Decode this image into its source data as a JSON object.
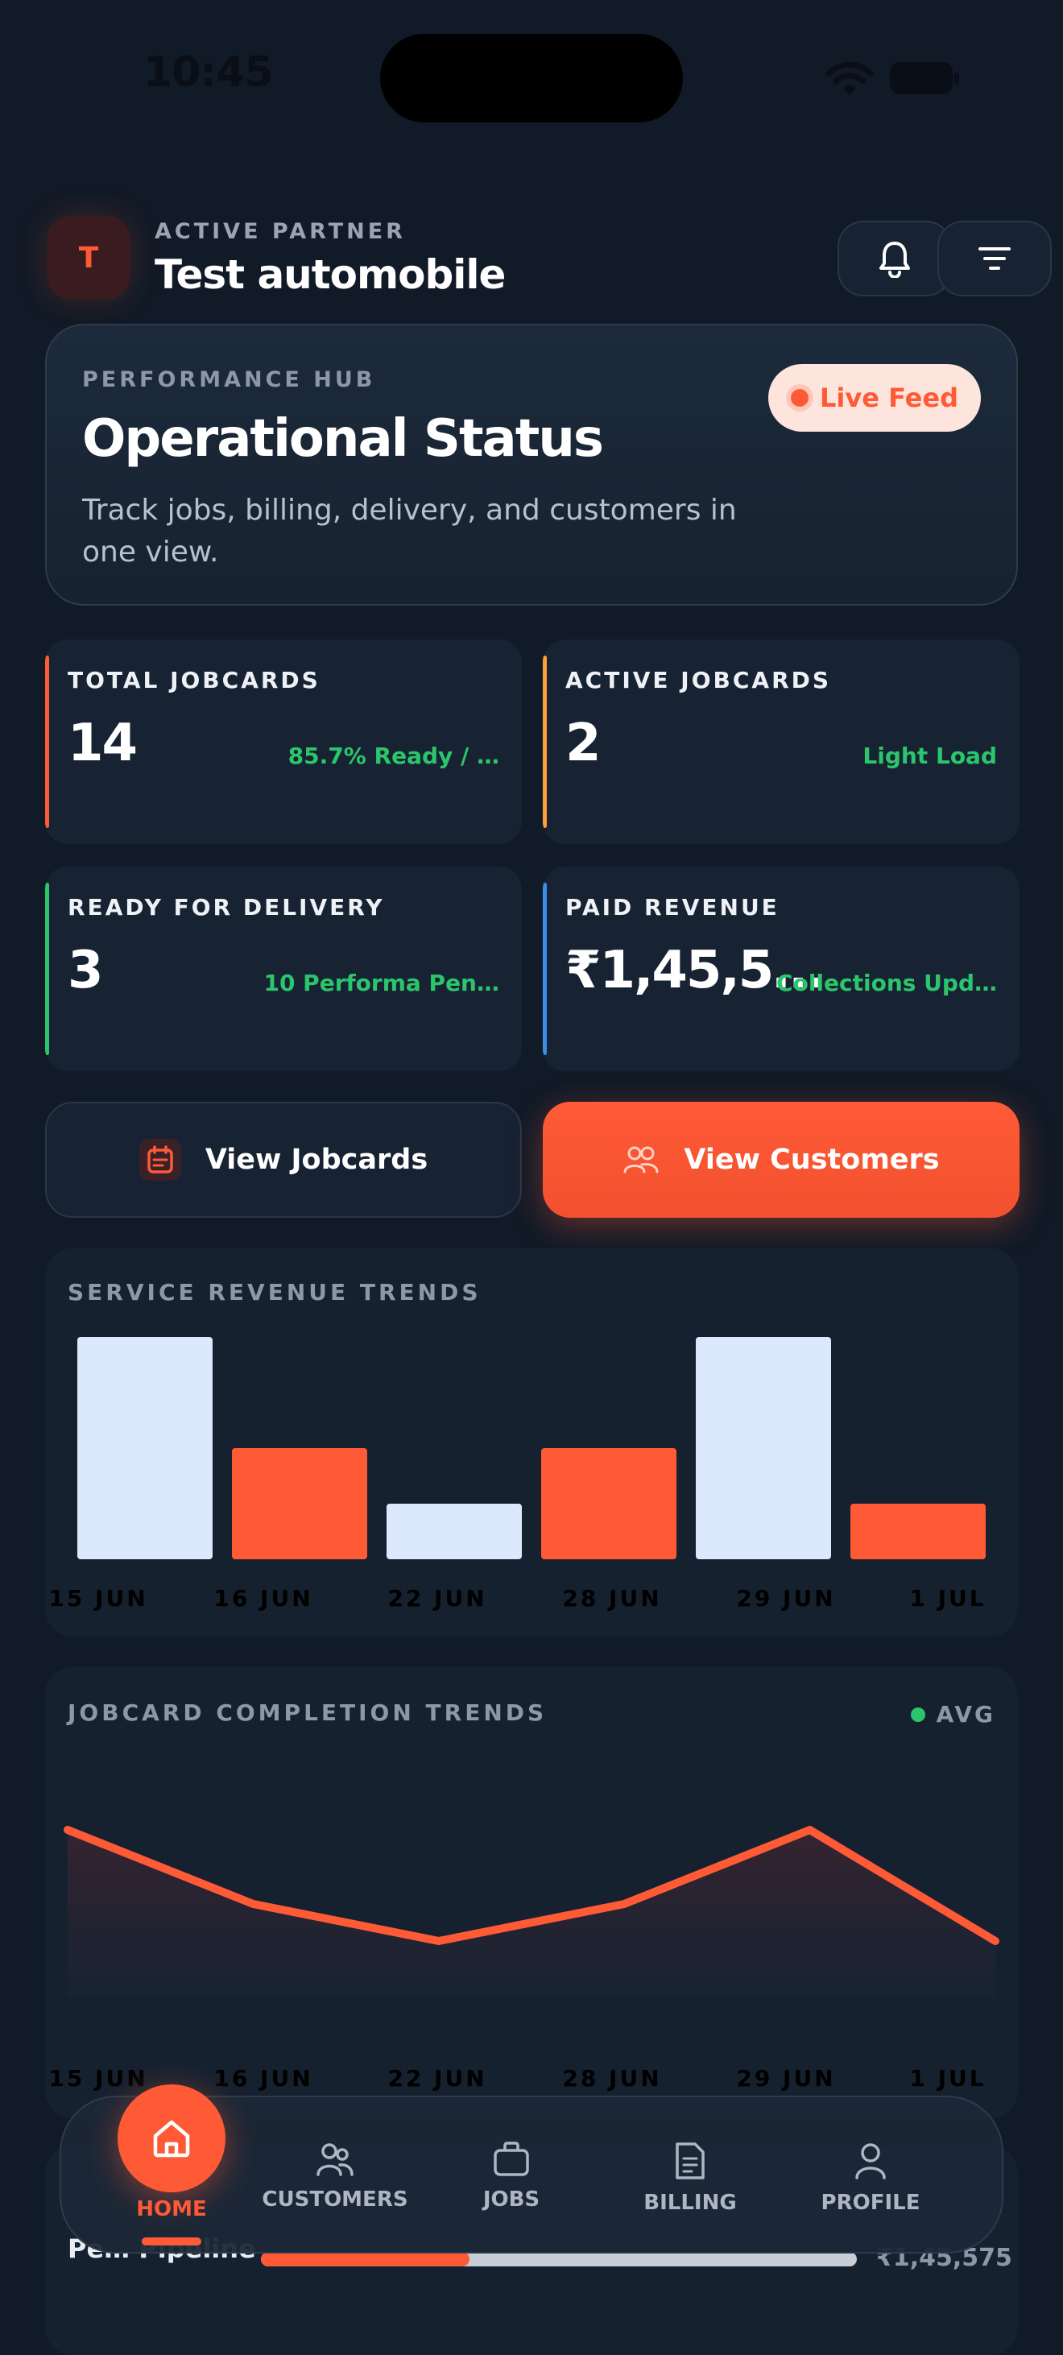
{
  "status_bar": {
    "time": "10:45"
  },
  "header": {
    "avatar_letter": "T",
    "label": "ACTIVE PARTNER",
    "name": "Test automobile",
    "icons": [
      "bell-icon",
      "filter-icon"
    ]
  },
  "hub": {
    "label": "PERFORMANCE HUB",
    "title": "Operational Status",
    "description": "Track jobs, billing, delivery, and customers in one view.",
    "badge": "Live Feed"
  },
  "stats": [
    {
      "label": "TOTAL JOBCARDS",
      "value": "14",
      "note": "85.7% Ready / …",
      "accent": "#ff5a36"
    },
    {
      "label": "ACTIVE JOBCARDS",
      "value": "2",
      "note": "Light Load",
      "accent": "#ff9f3a"
    },
    {
      "label": "READY FOR DELIVERY",
      "value": "3",
      "note": "10 Performa Pen…",
      "accent": "#2bc56b"
    },
    {
      "label": "PAID REVENUE",
      "value": "₹1,45,5…",
      "note": "Collections Upd…",
      "accent": "#3a8ee6"
    }
  ],
  "actions": {
    "jobcards": "View Jobcards",
    "customers": "View Customers"
  },
  "revenue_chart": {
    "title": "SERVICE REVENUE TRENDS"
  },
  "completion_chart": {
    "title": "JOBCARD COMPLETION TRENDS",
    "legend": "AVG"
  },
  "chart_data": [
    {
      "type": "bar",
      "title": "SERVICE REVENUE TRENDS",
      "categories": [
        "15 JUN",
        "16 JUN",
        "22 JUN",
        "28 JUN",
        "29 JUN",
        "1 JUL"
      ],
      "values": [
        100,
        50,
        25,
        50,
        100,
        25
      ],
      "colors": [
        "#dce8fb",
        "#ff5a36",
        "#dce8fb",
        "#ff5a36",
        "#dce8fb",
        "#ff5a36"
      ],
      "ylim": [
        0,
        100
      ],
      "grid": false
    },
    {
      "type": "area",
      "title": "JOBCARD COMPLETION TRENDS",
      "categories": [
        "15 JUN",
        "16 JUN",
        "22 JUN",
        "28 JUN",
        "29 JUN",
        "1 JUL"
      ],
      "values": [
        100,
        60,
        40,
        60,
        100,
        40
      ],
      "legend": "AVG",
      "color": "#ff5a36",
      "ylim": [
        0,
        100
      ],
      "grid": false
    }
  ],
  "pipeline": {
    "label": "Pe… Pipeline",
    "amount": "₹1,45,575",
    "progress": 0.35
  },
  "nav": {
    "items": [
      {
        "label": "HOME",
        "icon": "home-icon",
        "active": true
      },
      {
        "label": "CUSTOMERS",
        "icon": "customers-icon",
        "active": false
      },
      {
        "label": "JOBS",
        "icon": "briefcase-icon",
        "active": false
      },
      {
        "label": "BILLING",
        "icon": "document-icon",
        "active": false
      },
      {
        "label": "PROFILE",
        "icon": "profile-icon",
        "active": false
      }
    ]
  }
}
